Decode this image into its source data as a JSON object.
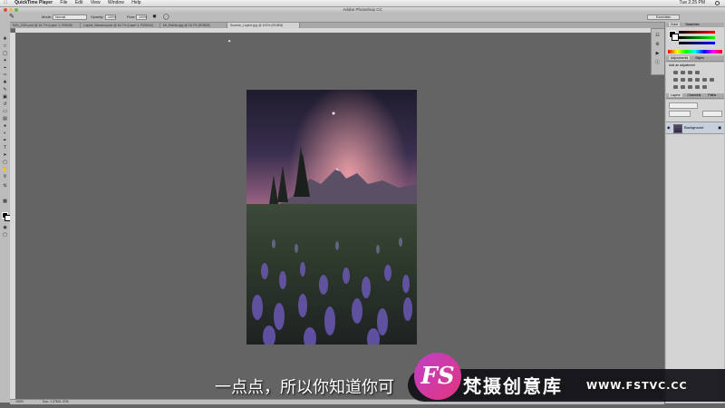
{
  "menubar": {
    "app_name": "QuickTime Player",
    "items": [
      "File",
      "Edit",
      "View",
      "Window",
      "Help"
    ],
    "clock": "Tue 2:25 PM"
  },
  "window": {
    "title": "Adobe Photoshop CC"
  },
  "options_bar": {
    "mode_label": "Mode:",
    "mode_value": "Normal",
    "opacity_label": "Opacity:",
    "opacity_value": "100%",
    "flow_label": "Flow:",
    "flow_value": "100%",
    "workspace": "Essentials"
  },
  "document_tabs": [
    {
      "label": "IMG_2341.psd @ 16.7% (Layer 1, RGB/8)",
      "active": false
    },
    {
      "label": "Lupine_Meadow.psd @ 16.7% (Layer 1, RGB/16)",
      "active": false
    },
    {
      "label": "Mt_Rainier.jpg @ 16.7% (RGB/8)",
      "active": false
    },
    {
      "label": "Sunrise_Lupine.jpg @ 100% (RGB/8)",
      "active": true
    }
  ],
  "status_bar": {
    "zoom": "100%",
    "doc_info": "Doc: 1.37M/1.37M"
  },
  "panels": {
    "color_tabs": [
      "Color",
      "Swatches"
    ],
    "adjustments_tabs": [
      "Adjustments",
      "Styles"
    ],
    "adjustments_hint": "Add an adjustment",
    "layers_tabs": [
      "Layers",
      "Channels",
      "Paths"
    ],
    "layer_name": "Background"
  },
  "subtitle": "一点点，所以你知道你可",
  "watermark": {
    "logo": "FS",
    "name": "梵摄创意库",
    "url": "WWW.FSTVC.CC"
  },
  "colors": {
    "canvas_bg": "#646464",
    "ui_gray": "#bcbcbc",
    "brand_pink": "#e0357d"
  }
}
